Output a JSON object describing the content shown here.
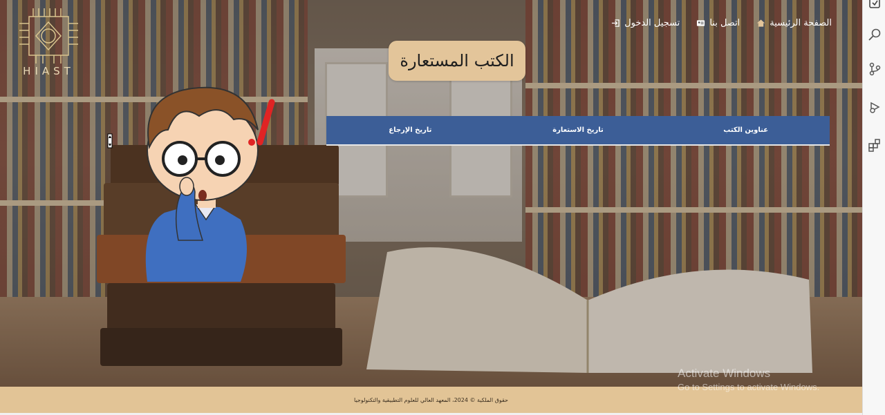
{
  "logo": {
    "text": "HIAST"
  },
  "nav": {
    "items": [
      {
        "label": "تسجيل الدخول",
        "icon": "login-icon"
      },
      {
        "label": "اتصل بنا",
        "icon": "contact-card-icon"
      },
      {
        "label": "الصفحة الرئيسية",
        "icon": "home-icon"
      }
    ]
  },
  "page": {
    "title": "الكتب المستعارة"
  },
  "table": {
    "headers": [
      "عناوين الكتب",
      "تاريخ الاستعارة",
      "تاريخ الإرجاع"
    ]
  },
  "footer": {
    "text": "حقوق الملكية © 2024، المعهد العالي للعلوم التطبيقية والتكنولوجيا"
  },
  "watermark": {
    "line1": "Activate Windows",
    "line2": "Go to Settings to activate Windows."
  },
  "sidebar": {
    "icons": [
      "new-file-icon",
      "search-icon",
      "source-control-icon",
      "debug-icon",
      "extensions-icon"
    ]
  },
  "colors": {
    "table_header": "#3c5e97",
    "title_box": "#e3c59a",
    "footer": "#e2c496"
  }
}
